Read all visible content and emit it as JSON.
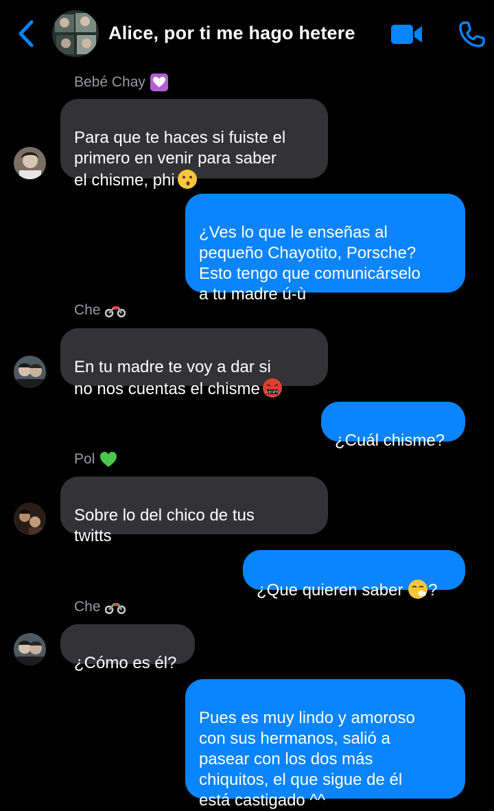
{
  "header": {
    "title": "Alice, por ti me hago hetere",
    "back_icon": "chevron-left-icon",
    "video_icon": "video-camera-icon",
    "call_icon": "phone-icon",
    "accent_color": "#0a84ff"
  },
  "messages": [
    {
      "type": "sender",
      "name": "Bebé Chay",
      "emoji": "purple-heart-box-icon"
    },
    {
      "type": "in",
      "text": "Para que te haces si fuiste el\nprimero en venir para saber\nel chisme, phi",
      "emoji": "kissing-face-icon"
    },
    {
      "type": "out",
      "text": "¿Ves lo que le enseñas al\npequeño Chayotito, Porsche?\nEsto tengo que comunicárselo\na tu madre ú-ù"
    },
    {
      "type": "sender",
      "name": "Che",
      "emoji": "motorcycle-icon"
    },
    {
      "type": "in",
      "text": "En tu madre te voy a dar si\nno nos cuentas el chisme",
      "emoji": "cursing-face-icon"
    },
    {
      "type": "out",
      "text": "¿Cuál chisme?"
    },
    {
      "type": "sender",
      "name": "Pol",
      "emoji": "green-heart-icon"
    },
    {
      "type": "in",
      "text": "Sobre lo del chico de tus\ntwitts"
    },
    {
      "type": "out",
      "text": "¿Que quieren saber ",
      "emoji": "face-exhaling-icon",
      "suffix": "?"
    },
    {
      "type": "sender",
      "name": "Che",
      "emoji": "motorcycle-icon"
    },
    {
      "type": "in",
      "text": "¿Cómo es él?"
    },
    {
      "type": "out",
      "text": "Pues es muy lindo y amoroso\ncon sus hermanos, salió a\npasear con los dos más\nchiquitos, el que sigue de él\nestá castigado ^^"
    }
  ],
  "colors": {
    "background": "#000000",
    "incoming_bubble": "#333335",
    "outgoing_bubble": "#0a84ff",
    "sender_name": "#9a9aa0"
  }
}
